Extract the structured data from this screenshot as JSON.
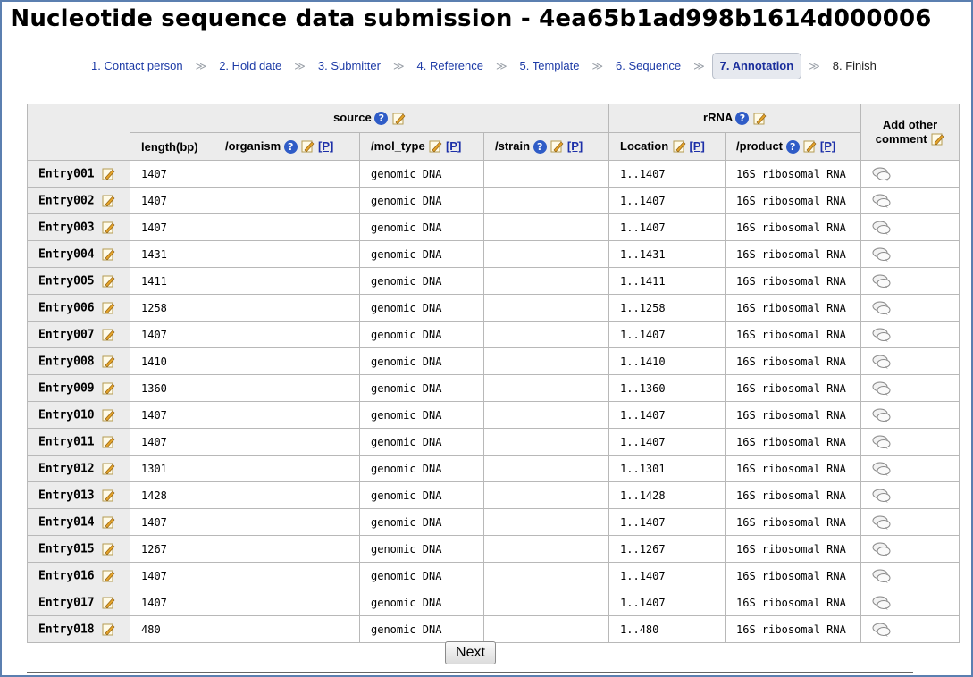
{
  "page": {
    "title": "Nucleotide sequence data submission - 4ea65b1ad998b1614d000006"
  },
  "steps": [
    {
      "label": "1. Contact person"
    },
    {
      "label": "2. Hold date"
    },
    {
      "label": "3. Submitter"
    },
    {
      "label": "4. Reference"
    },
    {
      "label": "5. Template"
    },
    {
      "label": "6. Sequence"
    },
    {
      "label": "7. Annotation"
    },
    {
      "label": "8. Finish"
    }
  ],
  "table": {
    "group_source": "source",
    "group_rrna": "rRNA",
    "add_comment": "Add other comment",
    "cols": {
      "length": "length(bp)",
      "organism": "/organism",
      "mol_type": "/mol_type",
      "strain": "/strain",
      "location": "Location",
      "product": "/product",
      "p": "[P]"
    },
    "rows": [
      {
        "entry": "Entry001",
        "length": "1407",
        "organism": "",
        "mol_type": "genomic DNA",
        "strain": "",
        "location": "1..1407",
        "product": "16S ribosomal RNA"
      },
      {
        "entry": "Entry002",
        "length": "1407",
        "organism": "",
        "mol_type": "genomic DNA",
        "strain": "",
        "location": "1..1407",
        "product": "16S ribosomal RNA"
      },
      {
        "entry": "Entry003",
        "length": "1407",
        "organism": "",
        "mol_type": "genomic DNA",
        "strain": "",
        "location": "1..1407",
        "product": "16S ribosomal RNA"
      },
      {
        "entry": "Entry004",
        "length": "1431",
        "organism": "",
        "mol_type": "genomic DNA",
        "strain": "",
        "location": "1..1431",
        "product": "16S ribosomal RNA"
      },
      {
        "entry": "Entry005",
        "length": "1411",
        "organism": "",
        "mol_type": "genomic DNA",
        "strain": "",
        "location": "1..1411",
        "product": "16S ribosomal RNA"
      },
      {
        "entry": "Entry006",
        "length": "1258",
        "organism": "",
        "mol_type": "genomic DNA",
        "strain": "",
        "location": "1..1258",
        "product": "16S ribosomal RNA"
      },
      {
        "entry": "Entry007",
        "length": "1407",
        "organism": "",
        "mol_type": "genomic DNA",
        "strain": "",
        "location": "1..1407",
        "product": "16S ribosomal RNA"
      },
      {
        "entry": "Entry008",
        "length": "1410",
        "organism": "",
        "mol_type": "genomic DNA",
        "strain": "",
        "location": "1..1410",
        "product": "16S ribosomal RNA"
      },
      {
        "entry": "Entry009",
        "length": "1360",
        "organism": "",
        "mol_type": "genomic DNA",
        "strain": "",
        "location": "1..1360",
        "product": "16S ribosomal RNA"
      },
      {
        "entry": "Entry010",
        "length": "1407",
        "organism": "",
        "mol_type": "genomic DNA",
        "strain": "",
        "location": "1..1407",
        "product": "16S ribosomal RNA"
      },
      {
        "entry": "Entry011",
        "length": "1407",
        "organism": "",
        "mol_type": "genomic DNA",
        "strain": "",
        "location": "1..1407",
        "product": "16S ribosomal RNA"
      },
      {
        "entry": "Entry012",
        "length": "1301",
        "organism": "",
        "mol_type": "genomic DNA",
        "strain": "",
        "location": "1..1301",
        "product": "16S ribosomal RNA"
      },
      {
        "entry": "Entry013",
        "length": "1428",
        "organism": "",
        "mol_type": "genomic DNA",
        "strain": "",
        "location": "1..1428",
        "product": "16S ribosomal RNA"
      },
      {
        "entry": "Entry014",
        "length": "1407",
        "organism": "",
        "mol_type": "genomic DNA",
        "strain": "",
        "location": "1..1407",
        "product": "16S ribosomal RNA"
      },
      {
        "entry": "Entry015",
        "length": "1267",
        "organism": "",
        "mol_type": "genomic DNA",
        "strain": "",
        "location": "1..1267",
        "product": "16S ribosomal RNA"
      },
      {
        "entry": "Entry016",
        "length": "1407",
        "organism": "",
        "mol_type": "genomic DNA",
        "strain": "",
        "location": "1..1407",
        "product": "16S ribosomal RNA"
      },
      {
        "entry": "Entry017",
        "length": "1407",
        "organism": "",
        "mol_type": "genomic DNA",
        "strain": "",
        "location": "1..1407",
        "product": "16S ribosomal RNA"
      },
      {
        "entry": "Entry018",
        "length": "480",
        "organism": "",
        "mol_type": "genomic DNA",
        "strain": "",
        "location": "1..480",
        "product": "16S ribosomal RNA"
      }
    ]
  },
  "buttons": {
    "next": "Next"
  },
  "icons": {
    "help": "question-mark-icon",
    "edit": "pencil-icon",
    "comment": "comment-bubble-icon"
  },
  "colors": {
    "link": "#1c3aa6",
    "header_bg": "#ececec",
    "frame": "#5b7fb0",
    "help_icon": "#2f5cc7"
  }
}
